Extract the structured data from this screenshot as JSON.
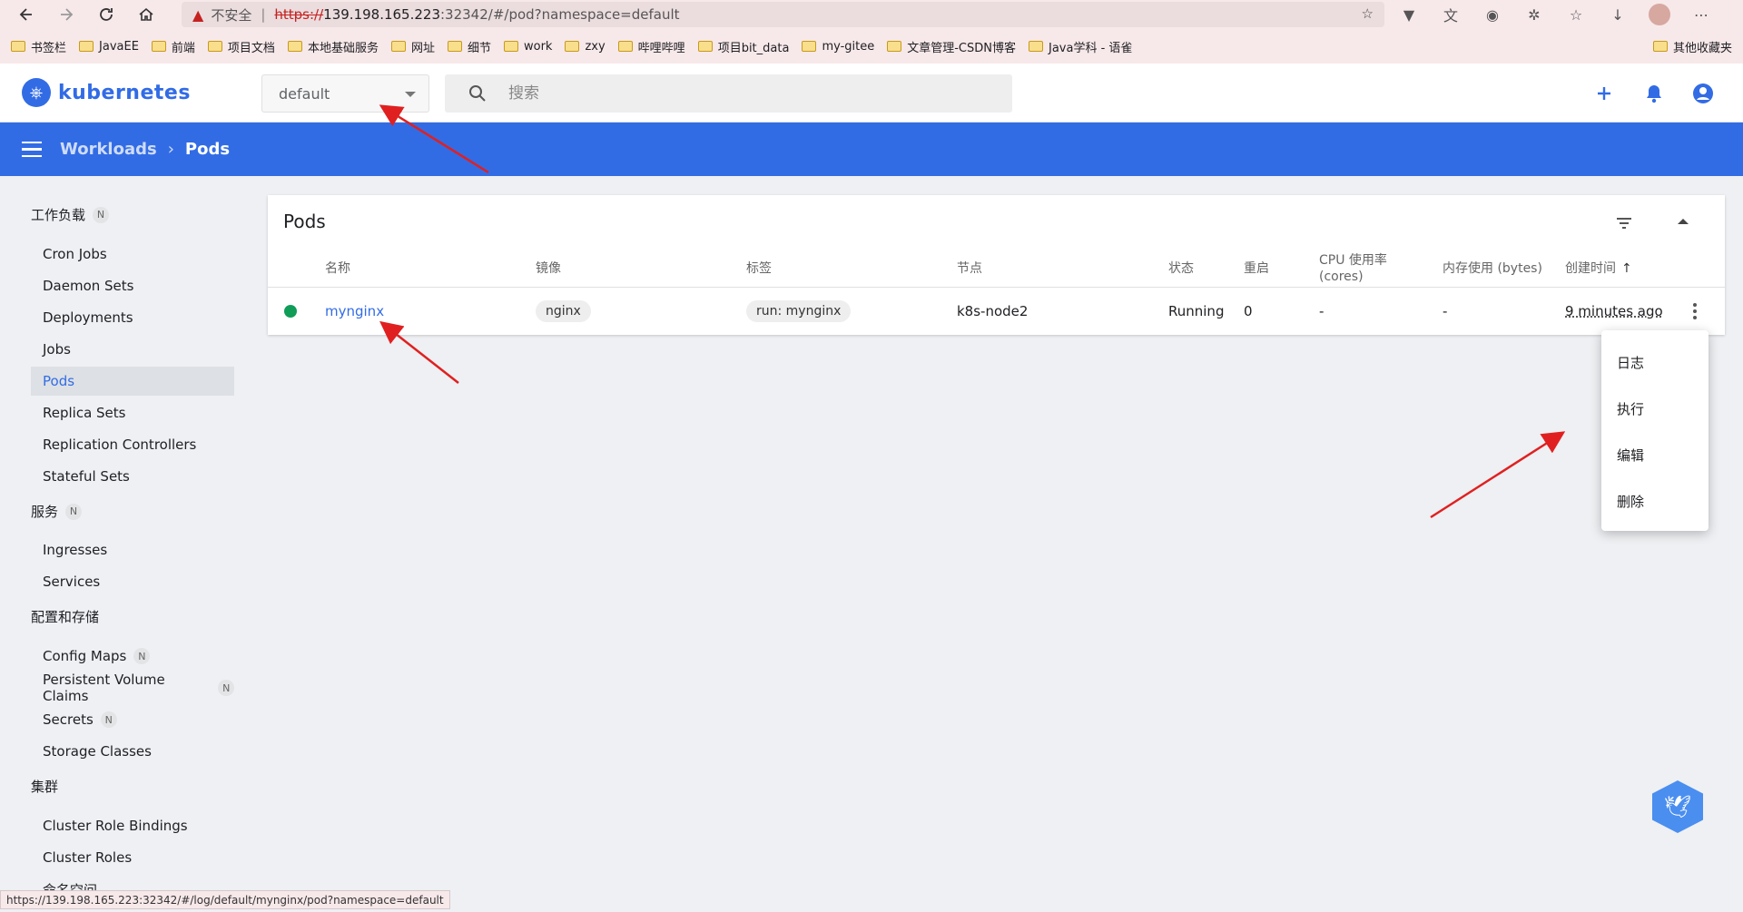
{
  "browser": {
    "not_secure": "不安全",
    "url_scheme": "https://",
    "url_host": "139.198.165.223",
    "url_rest": ":32342/#/pod?namespace=default",
    "bookmarks": [
      "书签栏",
      "JavaEE",
      "前端",
      "项目文档",
      "本地基础服务",
      "网址",
      "细节",
      "work",
      "zxy",
      "哔哩哔哩",
      "项目bit_data",
      "my-gitee",
      "文章管理-CSDN博客",
      "Java学科 - 语雀"
    ],
    "other_bookmarks": "其他收藏夹",
    "status_url": "https://139.198.165.223:32342/#/log/default/mynginx/pod?namespace=default"
  },
  "app": {
    "logo_text": "kubernetes",
    "namespace": "default",
    "search_placeholder": "搜索"
  },
  "breadcrumb": {
    "parent": "Workloads",
    "current": "Pods"
  },
  "sidebar": {
    "groups": [
      {
        "label": "工作负载",
        "badge": "N"
      },
      {
        "label": "服务",
        "badge": "N"
      },
      {
        "label": "配置和存储",
        "badge": ""
      },
      {
        "label": "集群",
        "badge": ""
      }
    ],
    "workloads": [
      "Cron Jobs",
      "Daemon Sets",
      "Deployments",
      "Jobs",
      "Pods",
      "Replica Sets",
      "Replication Controllers",
      "Stateful Sets"
    ],
    "services": [
      "Ingresses",
      "Services"
    ],
    "config": [
      {
        "label": "Config Maps",
        "badge": "N"
      },
      {
        "label": "Persistent Volume Claims",
        "badge": "N"
      },
      {
        "label": "Secrets",
        "badge": "N"
      },
      {
        "label": "Storage Classes",
        "badge": ""
      }
    ],
    "cluster": [
      "Cluster Role Bindings",
      "Cluster Roles",
      "命名空间"
    ]
  },
  "pods_card": {
    "title": "Pods",
    "columns": {
      "name": "名称",
      "image": "镜像",
      "labels": "标签",
      "node": "节点",
      "status": "状态",
      "restarts": "重启",
      "cpu_line1": "CPU 使用率",
      "cpu_line2": "(cores)",
      "memory": "内存使用 (bytes)",
      "created": "创建时间"
    },
    "rows": [
      {
        "name": "mynginx",
        "image": "nginx",
        "labels": "run: mynginx",
        "node": "k8s-node2",
        "status": "Running",
        "restarts": "0",
        "cpu": "-",
        "memory": "-",
        "created": "9 minutes ago"
      }
    ]
  },
  "context_menu": {
    "items": [
      "日志",
      "执行",
      "编辑",
      "删除"
    ]
  },
  "colors": {
    "brand": "#326ce5",
    "running": "#0f9d58",
    "annotation_arrow": "#e02020"
  }
}
